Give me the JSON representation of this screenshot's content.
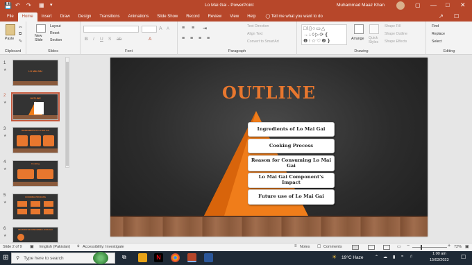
{
  "window": {
    "title": "Lo Mai Gai  -  PowerPoint",
    "user": "Muhammad Maaz Khan"
  },
  "ribbon_tabs": [
    "File",
    "Home",
    "Insert",
    "Draw",
    "Design",
    "Transitions",
    "Animations",
    "Slide Show",
    "Record",
    "Review",
    "View",
    "Help"
  ],
  "active_tab": "Home",
  "tell_me": "Tell me what you want to do",
  "ribbon": {
    "clipboard": {
      "paste": "Paste",
      "label": "Clipboard"
    },
    "slides": {
      "new_slide": "New\nSlide",
      "layout": "Layout",
      "reset": "Reset",
      "section": "Section",
      "label": "Slides"
    },
    "font": {
      "label": "Font"
    },
    "paragraph": {
      "text_direction": "Text Direction",
      "align_text": "Align Text",
      "convert_smartart": "Convert to SmartArt",
      "label": "Paragraph"
    },
    "drawing": {
      "arrange": "Arrange",
      "quick_styles": "Quick\nStyles",
      "shape_fill": "Shape Fill",
      "shape_outline": "Shape Outline",
      "shape_effects": "Shape Effects",
      "label": "Drawing"
    },
    "editing": {
      "find": "Find",
      "replace": "Replace",
      "select": "Select",
      "label": "Editing"
    }
  },
  "thumbnails": [
    {
      "num": "1",
      "title": "LO MAI GAI"
    },
    {
      "num": "2",
      "title": "OUTLINE",
      "selected": true
    },
    {
      "num": "3",
      "title": "INGREDIENTS OF LO MAI GAI"
    },
    {
      "num": "4",
      "title": "Cooking"
    },
    {
      "num": "5",
      "title": "COOKING PROCESS"
    },
    {
      "num": "6",
      "title": "REASON FOR CONSUMING LO MAI GAI"
    }
  ],
  "slide": {
    "title": "OUTLINE",
    "items": [
      "Ingredients of Lo Mai Gai",
      "Cooking Process",
      "Reason for Consuming Lo Mai Gai",
      "Lo Mai Gai Component’s Impact",
      "Future use of Lo Mai Gai"
    ]
  },
  "status": {
    "slide_count": "Slide 2 of 9",
    "language": "English (Pakistan)",
    "accessibility": "Accessibility: Investigate",
    "notes": "Notes",
    "comments": "Comments",
    "zoom": "72%"
  },
  "taskbar": {
    "search_placeholder": "Type here to search",
    "weather": "19°C  Haze",
    "time": "1:00 am",
    "date": "15/03/2023"
  },
  "colors": {
    "accent": "#b7472a",
    "slide_title": "#e8772e",
    "pyramid": "#f07d1a"
  }
}
